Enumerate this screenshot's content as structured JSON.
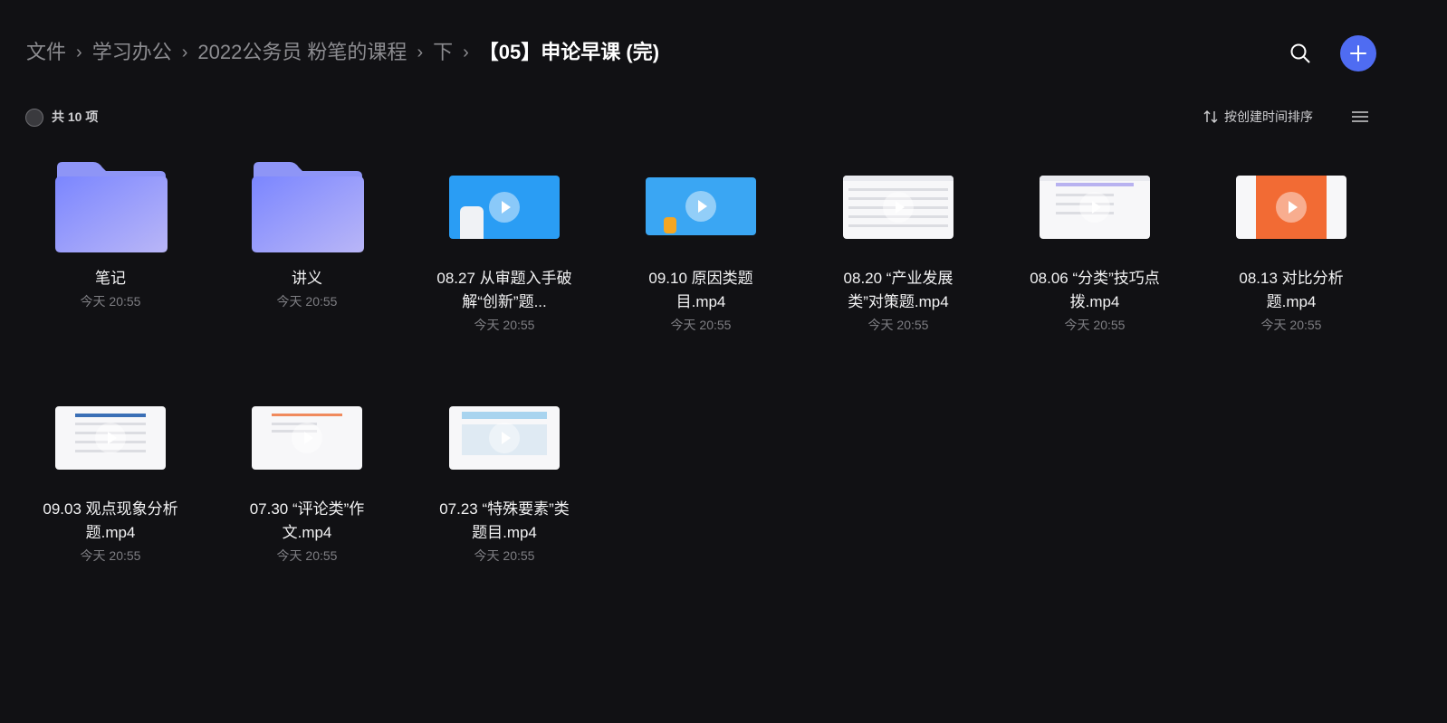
{
  "breadcrumb": {
    "items": [
      "文件",
      "学习办公",
      "2022公务员 粉笔的课程",
      "下"
    ],
    "current": "【05】申论早课 (完)"
  },
  "toolbar": {
    "count_label": "共 10 项",
    "sort_label": "按创建时间排序"
  },
  "icons": {
    "search": "search-icon",
    "add": "plus-icon",
    "sort": "sort-arrows-icon",
    "view": "list-view-icon",
    "folder": "folder-icon",
    "play": "play-icon"
  },
  "colors": {
    "background": "#111114",
    "accent": "#4f6cf2",
    "folder": "#8c9cff"
  },
  "files": [
    {
      "name": "笔记",
      "time": "今天 20:55",
      "type": "folder"
    },
    {
      "name": "讲义",
      "time": "今天 20:55",
      "type": "folder"
    },
    {
      "name": "08.27 从审题入手破解“创新”题...",
      "time": "今天 20:55",
      "type": "video"
    },
    {
      "name": "09.10 原因类题目.mp4",
      "time": "今天 20:55",
      "type": "video"
    },
    {
      "name": "08.20 “产业发展类”对策题.mp4",
      "time": "今天 20:55",
      "type": "video"
    },
    {
      "name": "08.06 “分类”技巧点拨.mp4",
      "time": "今天 20:55",
      "type": "video"
    },
    {
      "name": "08.13 对比分析题.mp4",
      "time": "今天 20:55",
      "type": "video"
    },
    {
      "name": "09.03 观点现象分析题.mp4",
      "time": "今天 20:55",
      "type": "video"
    },
    {
      "name": "07.30 “评论类”作文.mp4",
      "time": "今天 20:55",
      "type": "video"
    },
    {
      "name": "07.23 “特殊要素”类题目.mp4",
      "time": "今天 20:55",
      "type": "video"
    }
  ]
}
